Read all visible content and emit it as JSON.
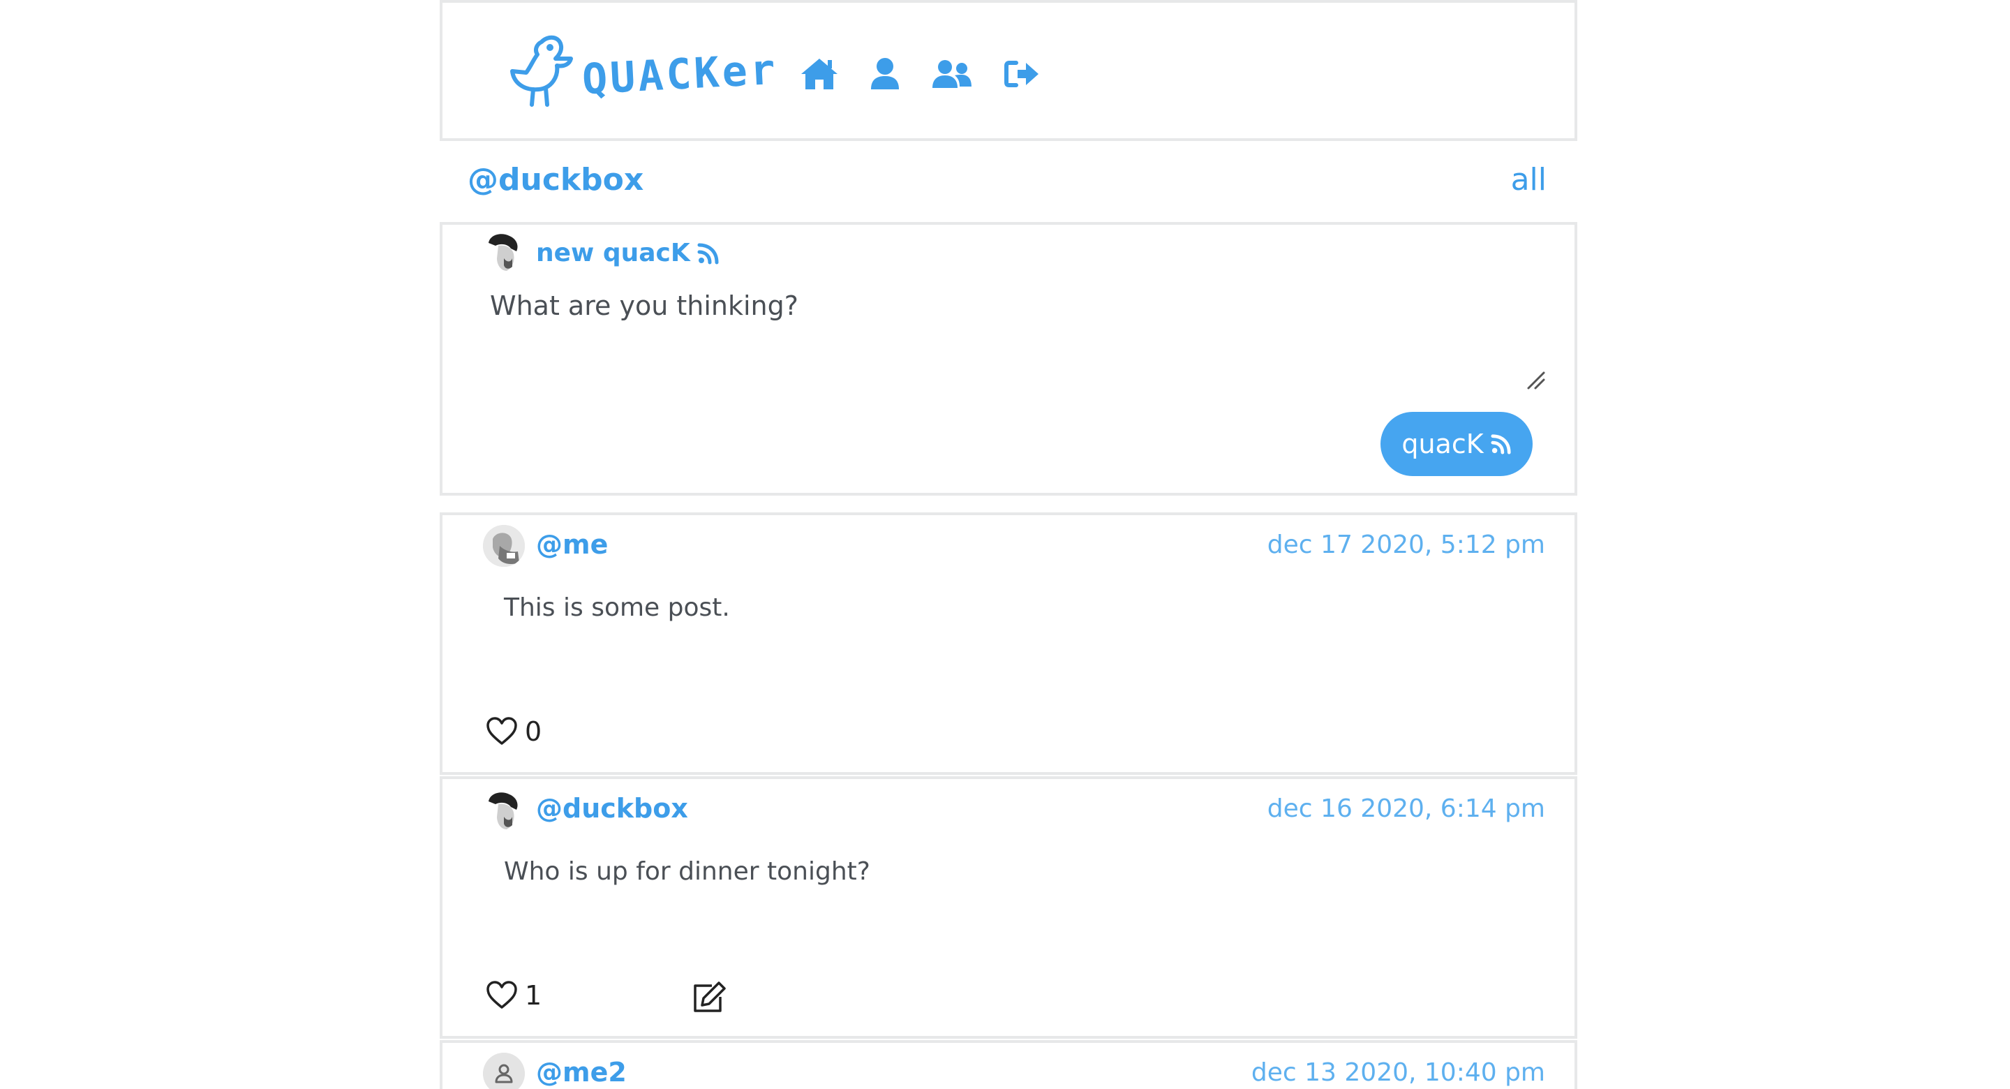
{
  "app": {
    "name": "QUACKer"
  },
  "nav": {
    "items": [
      {
        "icon": "home-icon"
      },
      {
        "icon": "user-icon"
      },
      {
        "icon": "users-icon"
      },
      {
        "icon": "sign-out-icon"
      }
    ]
  },
  "context": {
    "handle": "@duckbox",
    "filter_label": "all"
  },
  "compose": {
    "title": "new quacK",
    "placeholder": "What are you thinking?",
    "button_label": "quacK"
  },
  "posts": [
    {
      "author": "@me",
      "date": "dec 17 2020, 5:12 pm",
      "text": "This is some post.",
      "likes": "0",
      "editable": false
    },
    {
      "author": "@duckbox",
      "date": "dec 16 2020, 6:14 pm",
      "text": "Who is up for dinner tonight?",
      "likes": "1",
      "editable": true
    },
    {
      "author": "@me2",
      "date": "dec 13 2020, 10:40 pm",
      "text": "",
      "likes": "",
      "editable": false
    }
  ],
  "colors": {
    "accent": "#3d9de9",
    "button": "#46a5f0",
    "border": "#e7e8e9",
    "text": "#4a4f55"
  }
}
